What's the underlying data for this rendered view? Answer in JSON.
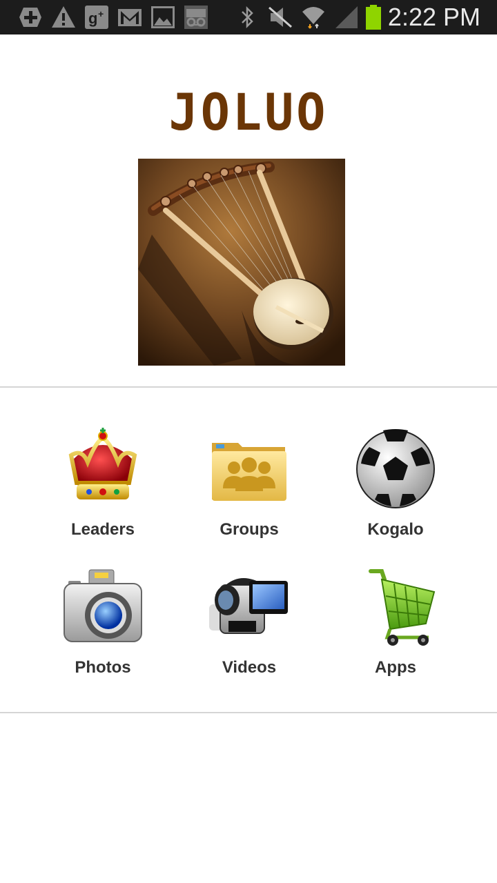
{
  "status_bar": {
    "time": "2:22 PM",
    "notification_icons": [
      "add-icon",
      "warning-icon",
      "google-plus-icon",
      "gmail-icon",
      "gallery-icon",
      "voicemail-icon"
    ],
    "system_icons": [
      "bluetooth-icon",
      "mute-icon",
      "wifi-icon",
      "signal-icon",
      "battery-icon"
    ],
    "battery_color": "#8fd400"
  },
  "header": {
    "title": "JOLUO",
    "title_color": "#6b3606",
    "image_icon": "nyatiti-lyre-image"
  },
  "menu": {
    "items": [
      {
        "label": "Leaders",
        "icon": "crown-icon"
      },
      {
        "label": "Groups",
        "icon": "group-folder-icon"
      },
      {
        "label": "Kogalo",
        "icon": "soccer-ball-icon"
      },
      {
        "label": "Photos",
        "icon": "camera-icon"
      },
      {
        "label": "Videos",
        "icon": "video-camera-icon"
      },
      {
        "label": "Apps",
        "icon": "shopping-cart-icon"
      }
    ]
  }
}
